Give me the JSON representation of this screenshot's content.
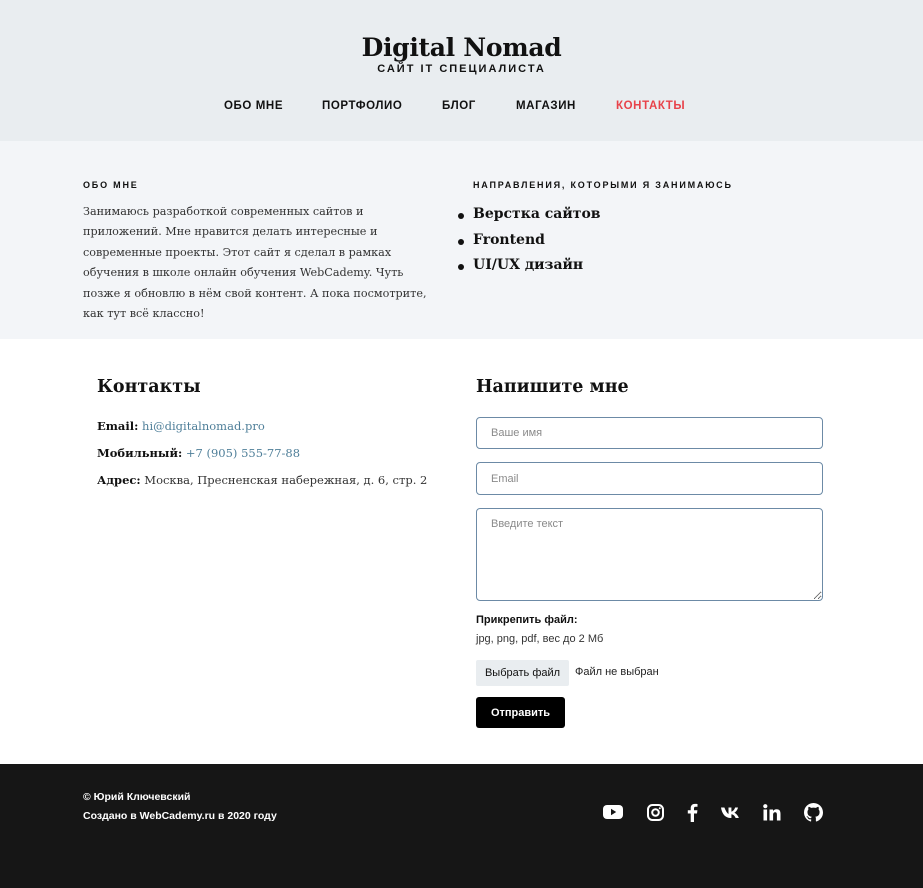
{
  "header": {
    "logo": "Digital Nomad",
    "tagline": "САЙТ IT СПЕЦИАЛИСТА",
    "nav": [
      {
        "label": "ОБО МНЕ"
      },
      {
        "label": "ПОРТФОЛИО"
      },
      {
        "label": "БЛОГ"
      },
      {
        "label": "МАГАЗИН"
      },
      {
        "label": "КОНТАКТЫ",
        "active": true
      }
    ],
    "active_color": "#e8424a"
  },
  "about": {
    "heading": "ОБО МНЕ",
    "text": "Занимаюсь разработкой современных сайтов и приложений. Мне нравится делать интересные и современные проекты. Этот сайт я сделал в рамках обучения в школе онлайн обучения WebCademy. Чуть позже я обновлю в нём свой контент. А пока посмотрите, как тут всё классно!",
    "directions_heading": "НАПРАВЛЕНИЯ, КОТОРЫМИ Я ЗАНИМАЮСЬ",
    "directions": [
      "Верстка сайтов",
      "Frontend",
      "UI/UX дизайн"
    ]
  },
  "contacts": {
    "title": "Контакты",
    "email_label": "Email:",
    "email_value": "hi@digitalnomad.pro",
    "phone_label": "Мобильный:",
    "phone_value": "+7 (905) 555-77-88",
    "address_label": "Адрес:",
    "address_value": "Москва, Пресненская набережная, д. 6, стр. 2",
    "link_color": "#4f7f99"
  },
  "form": {
    "title": "Напишите мне",
    "name_placeholder": "Ваше имя",
    "email_placeholder": "Email",
    "message_placeholder": "Введите текст",
    "attach_label": "Прикрепить файл:",
    "attach_hint": "jpg, png, pdf, вес до 2 Мб",
    "file_button": "Выбрать файл",
    "file_status": "Файл не выбран",
    "submit": "Отправить"
  },
  "footer": {
    "copyright": "© Юрий Ключевский",
    "created": "Создано в WebCademy.ru в 2020 году",
    "social_icons": [
      "youtube-icon",
      "instagram-icon",
      "facebook-icon",
      "vk-icon",
      "linkedin-icon",
      "github-icon"
    ]
  }
}
